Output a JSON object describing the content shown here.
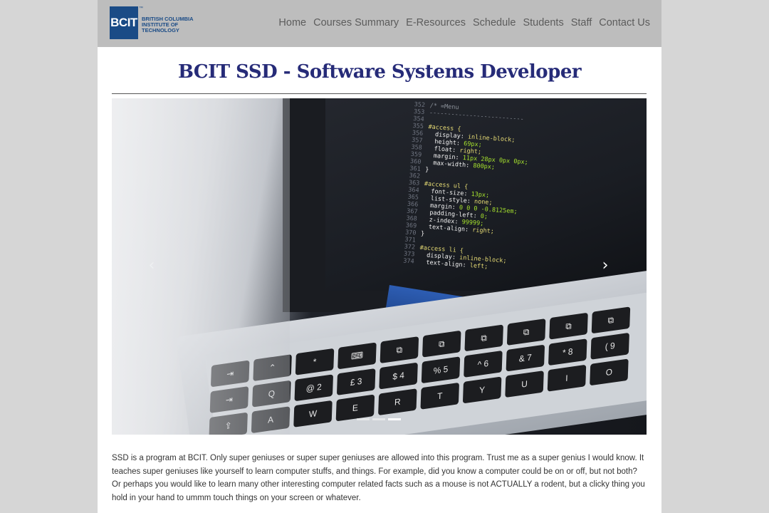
{
  "brand": {
    "logo_text": "BCIT",
    "logo_tm": "™",
    "logo_subtitle_line1": "BRITISH COLUMBIA",
    "logo_subtitle_line2": "INSTITUTE OF TECHNOLOGY"
  },
  "nav": {
    "items": [
      {
        "label": "Home"
      },
      {
        "label": "Courses Summary"
      },
      {
        "label": "E-Resources"
      },
      {
        "label": "Schedule"
      },
      {
        "label": "Students"
      },
      {
        "label": "Staff"
      },
      {
        "label": "Contact Us"
      }
    ]
  },
  "main": {
    "title": "BCIT SSD - Software Systems Developer",
    "description": "SSD is a program at BCIT. Only super geniuses or super super geniuses are allowed into this program. Trust me as a super genius I would know. It teaches super geniuses like yourself to learn computer stuffs, and things. For example, did you know a computer could be on or off, but not both? Or perhaps you would like to learn many other interesting computer related facts such as a mouse is not ACTUALLY a rodent, but a clicky thing you hold in your hand to ummm touch things on your screen or whatever."
  },
  "carousel": {
    "prev_symbol": "‹",
    "next_symbol": "›",
    "active_index": 2,
    "slide_count": 3
  },
  "colors": {
    "page_bg": "#d6d6d6",
    "header_bg": "#bdbdbd",
    "title": "#262b78",
    "nav_text": "#5c5c5c",
    "logo_blue": "#1a4b86"
  }
}
